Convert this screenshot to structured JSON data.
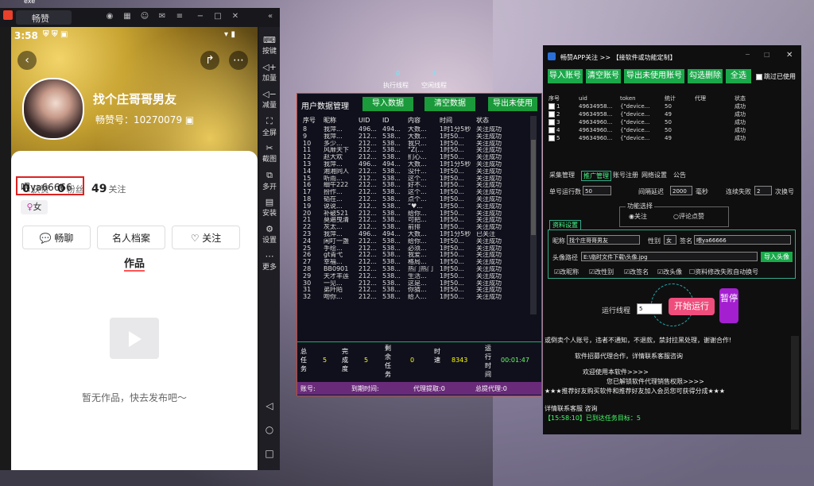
{
  "desktop": {
    "corner_label": "exe"
  },
  "emulator": {
    "tab_label": "畅赞",
    "status_time": "3:58",
    "profile": {
      "nickname": "找个庄哥哥男友",
      "changzan_id": "畅赞号：10270079",
      "likes_value": "0",
      "likes_label": "获赞",
      "fans_value": "0",
      "fans_label": "粉丝",
      "follows_value": "49",
      "follows_label": "关注",
      "signature": "喂ya66666",
      "gender": "女",
      "chat_button": "畅聊",
      "profile_button": "名人档案",
      "follow_button": "关注",
      "works_tab": "作品",
      "empty_text": "暂无作品，快去发布吧～"
    },
    "sidebar": [
      "按键",
      "加量",
      "减量",
      "全屏",
      "截图",
      "多开",
      "安装",
      "设置",
      "更多"
    ]
  },
  "mid_panel": {
    "exec_threads_value": "0",
    "exec_threads_label": "执行线程",
    "idle_threads_value": "5",
    "idle_threads_label": "空闲线程",
    "title": "用户数据管理",
    "import_button": "导入数据",
    "clear_button": "清空数据",
    "export_button": "导出未使用",
    "columns": [
      "序号",
      "昵称",
      "UID",
      "ID",
      "内容",
      "时间",
      "状态"
    ],
    "rows": [
      [
        "8",
        "我萍...",
        "496...",
        "494...",
        "大数...",
        "1时1分5秒",
        "关注成功"
      ],
      [
        "9",
        "我萍...",
        "212...",
        "538...",
        "大数...",
        "1时50...",
        "关注成功"
      ],
      [
        "10",
        "多少...",
        "212...",
        "538...",
        "我只...",
        "1时50...",
        "关注成功"
      ],
      [
        "11",
        "风靡天下",
        "212...",
        "538...",
        "\"Z(...",
        "1时50...",
        "关注成功"
      ],
      [
        "12",
        "赵大欢",
        "212...",
        "538...",
        "扪心...",
        "1时50...",
        "关注成功"
      ],
      [
        "13",
        "我萍...",
        "496...",
        "494...",
        "大数...",
        "1时1分5秒",
        "关注成功"
      ],
      [
        "14",
        "湘湘同人",
        "212...",
        "538...",
        "没什...",
        "1时50...",
        "关注成功"
      ],
      [
        "15",
        "听雨...",
        "212...",
        "538...",
        "这个...",
        "1时50...",
        "关注成功"
      ],
      [
        "16",
        "细牛222",
        "212...",
        "538...",
        "好不...",
        "1时50...",
        "关注成功"
      ],
      [
        "17",
        "扮作...",
        "212...",
        "538...",
        "这个...",
        "1时50...",
        "关注成功"
      ],
      [
        "18",
        "韬在...",
        "212...",
        "538...",
        "点个...",
        "1时50...",
        "关注成功"
      ],
      [
        "19",
        "说说...",
        "212...",
        "538...",
        "“♥...",
        "1时50...",
        "关注成功"
      ],
      [
        "20",
        "补破521",
        "212...",
        "538...",
        "给你...",
        "1时50...",
        "关注成功"
      ],
      [
        "21",
        "莫遍曳清",
        "212...",
        "538...",
        "可把...",
        "1时50...",
        "关注成功"
      ],
      [
        "22",
        "灰太...",
        "212...",
        "538...",
        "前排",
        "1时50...",
        "关注成功"
      ],
      [
        "23",
        "我萍...",
        "496...",
        "494...",
        "大数...",
        "1时1分5秒",
        "已关注"
      ],
      [
        "24",
        "闲叮一盏",
        "212...",
        "538...",
        "给你...",
        "1时50...",
        "关注成功"
      ],
      [
        "25",
        "手绘...",
        "212...",
        "538...",
        "必须...",
        "1时50...",
        "关注成功"
      ],
      [
        "26",
        "gt青弋",
        "212...",
        "538...",
        "我爱...",
        "1时50...",
        "关注成功"
      ],
      [
        "27",
        "幸福...",
        "212...",
        "538...",
        "格局...",
        "1时50...",
        "关注成功"
      ],
      [
        "28",
        "BB0901",
        "212...",
        "538...",
        "热门热门",
        "1时50...",
        "关注成功"
      ],
      [
        "29",
        "天才丰莲",
        "212...",
        "538...",
        "生活...",
        "1时50...",
        "关注成功"
      ],
      [
        "30",
        "一见...",
        "212...",
        "538...",
        "这是...",
        "1时50...",
        "关注成功"
      ],
      [
        "31",
        "弟阡陌",
        "212...",
        "538...",
        "你猜...",
        "1时50...",
        "关注成功"
      ],
      [
        "32",
        "吻你...",
        "212...",
        "538...",
        "给人...",
        "1时50...",
        "关注成功"
      ]
    ],
    "summary": {
      "total_label": "总任务",
      "total_value": "5",
      "done_label": "完成度",
      "done_value": "5",
      "left_label": "剩余任务",
      "left_value": "0",
      "time_label": "时速",
      "time_value": "8343",
      "run_label": "运行时间",
      "run_value": "00:01:47"
    },
    "footer": {
      "account": "账号:",
      "expire": "到期时间:",
      "proxy_fetch": "代理提取:0",
      "proxy_total": "总提代理:0"
    }
  },
  "right_panel": {
    "title": "畅赞APP关注 >> 【接软件或功能定制】",
    "buttons": [
      "导入账号",
      "清空账号",
      "导出未使用账号",
      "勾选删除",
      "全选"
    ],
    "skip_label": "跳过已使用",
    "columns": [
      "序号",
      "uid",
      "token",
      "统计",
      "代理",
      "状态"
    ],
    "rows": [
      [
        "1",
        "49634958...",
        "{\"device...",
        "50",
        "",
        "成功"
      ],
      [
        "2",
        "49634958...",
        "{\"device...",
        "49",
        "",
        "成功"
      ],
      [
        "3",
        "49634960...",
        "{\"device...",
        "50",
        "",
        "成功"
      ],
      [
        "4",
        "49634960...",
        "{\"device...",
        "50",
        "",
        "成功"
      ],
      [
        "5",
        "49634960...",
        "{\"device...",
        "49",
        "",
        "成功"
      ]
    ],
    "tabs": [
      "采集管理",
      "推广管理",
      "账号注册",
      "网络设置",
      "公告"
    ],
    "single_run_label": "单号运行数",
    "single_run_value": "50",
    "interval_label": "间隔延迟",
    "interval_value": "2000",
    "interval_unit": "毫秒",
    "fail_label": "连续失败",
    "fail_value": "2",
    "fail_unit": "次换号",
    "func_group": "功能选择",
    "opt_follow": "关注",
    "opt_like": "评论点赞",
    "profile_tab": "资料设置",
    "nick_label": "昵称",
    "nick_value": "找个庄哥哥男友",
    "gender_label": "性别",
    "gender_value": "女",
    "sign_label": "签名",
    "sign_value": "喂ya66666",
    "avatar_label": "头像路径",
    "avatar_value": "E:\\临时文件下载\\头像.jpg",
    "import_avatar": "导入头像",
    "cb_nick": "改昵称",
    "cb_gender": "改性别",
    "cb_sign": "改签名",
    "cb_avatar": "改头像",
    "cb_auto": "资料修改失败自动换号",
    "threads_label": "运行线程",
    "threads_value": "5",
    "start_button": "开始运行",
    "pause_button": "暂停",
    "log": [
      "或倒卖个人账号，违者不通知，不退款，禁封拉黑处理，谢谢合作!",
      "软件招募代理合作，详情联系客服咨询",
      "欢迎使用本软件>>>>",
      "您已解锁软件代理销售权限>>>>",
      "★★★推荐好友购买软件和推荐好友加入会员您可获得分成★★★",
      "详情联系客服  咨询",
      "【15:58:10】已到达任务目标：5"
    ]
  }
}
